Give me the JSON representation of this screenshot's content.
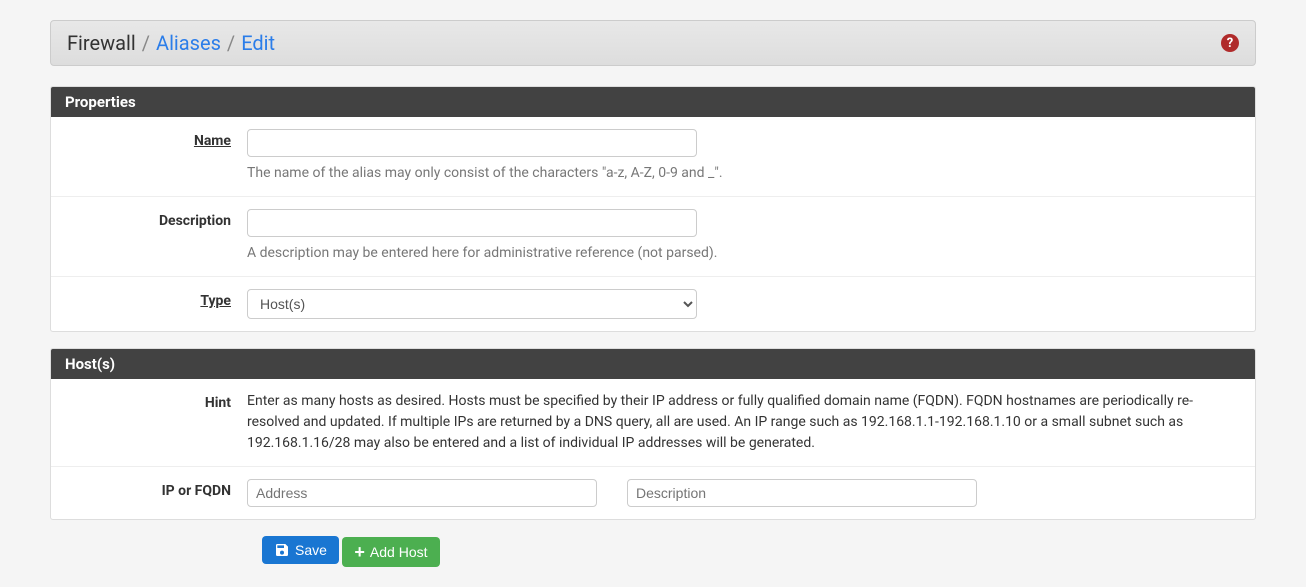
{
  "breadcrumb": {
    "root": "Firewall",
    "aliases": "Aliases",
    "edit": "Edit",
    "sep": "/"
  },
  "panels": {
    "properties": {
      "title": "Properties",
      "name_label": "Name",
      "name_help": "The name of the alias may only consist of the characters \"a-z, A-Z, 0-9 and _\".",
      "desc_label": "Description",
      "desc_help": "A description may be entered here for administrative reference (not parsed).",
      "type_label": "Type",
      "type_value": "Host(s)"
    },
    "hosts": {
      "title": "Host(s)",
      "hint_label": "Hint",
      "hint_text": "Enter as many hosts as desired. Hosts must be specified by their IP address or fully qualified domain name (FQDN). FQDN hostnames are periodically re-resolved and updated. If multiple IPs are returned by a DNS query, all are used. An IP range such as 192.168.1.1-192.168.1.10 or a small subnet such as 192.168.1.16/28 may also be entered and a list of individual IP addresses will be generated.",
      "ip_label": "IP or FQDN",
      "address_placeholder": "Address",
      "desc_placeholder": "Description"
    }
  },
  "buttons": {
    "save": "Save",
    "add_host": "Add Host"
  },
  "icons": {
    "help": "?"
  }
}
